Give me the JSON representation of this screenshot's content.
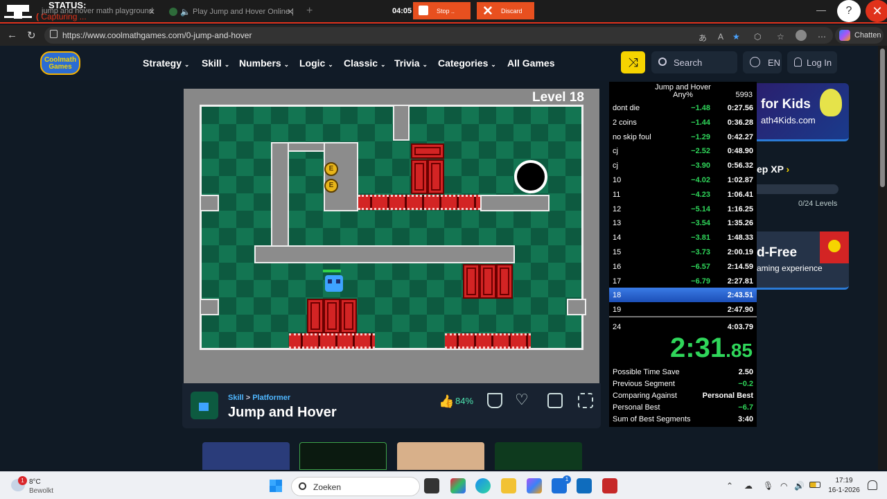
{
  "recorder": {
    "status_label": "STATUS:",
    "capturing_label": "Capturing ...",
    "timer": "04:05",
    "stop_label": "Stop ..",
    "discard_label": "Discard"
  },
  "tabs": [
    {
      "title": "jump and hover math playground"
    },
    {
      "title": "Play Jump and Hover Online |"
    }
  ],
  "browser": {
    "url": "https://www.coolmathgames.com/0-jump-and-hover",
    "chatten_label": "Chatten"
  },
  "site": {
    "logo_text": "Coolmath Games",
    "nav": [
      "Strategy",
      "Skill",
      "Numbers",
      "Logic",
      "Classic",
      "Trivia",
      "Categories",
      "All Games"
    ],
    "search_label": "Search",
    "lang_label": "EN",
    "login_label": "Log In"
  },
  "game": {
    "level_label": "Level 18",
    "category": "Skill",
    "subcategory": "Platformer",
    "title": "Jump and Hover",
    "like_percent": "84%"
  },
  "sidebar": {
    "ad1_title": "for Kids",
    "ad1_sub": "ath4Kids.com",
    "xp_label": "ep XP",
    "levels_label": "0/24 Levels",
    "ad2_title": "d-Free",
    "ad2_sub": "aming experience"
  },
  "splits": {
    "title": "Jump and Hover",
    "category": "Any%",
    "attempts": "5993",
    "rows": [
      {
        "name": "dont die",
        "delta": "−1.48",
        "time": "0:27.56"
      },
      {
        "name": "2 coins",
        "delta": "−1.44",
        "time": "0:36.28"
      },
      {
        "name": "no skip foul",
        "delta": "−1.29",
        "time": "0:42.27"
      },
      {
        "name": "cj",
        "delta": "−2.52",
        "time": "0:48.90"
      },
      {
        "name": "cj",
        "delta": "−3.90",
        "time": "0:56.32"
      },
      {
        "name": "10",
        "delta": "−4.02",
        "time": "1:02.87"
      },
      {
        "name": "11",
        "delta": "−4.23",
        "time": "1:06.41"
      },
      {
        "name": "12",
        "delta": "−5.14",
        "time": "1:16.25"
      },
      {
        "name": "13",
        "delta": "−3.54",
        "time": "1:35.26"
      },
      {
        "name": "14",
        "delta": "−3.81",
        "time": "1:48.33"
      },
      {
        "name": "15",
        "delta": "−3.73",
        "time": "2:00.19"
      },
      {
        "name": "16",
        "delta": "−6.57",
        "time": "2:14.59"
      },
      {
        "name": "17",
        "delta": "−6.79",
        "time": "2:27.81"
      },
      {
        "name": "18",
        "delta": "",
        "time": "2:43.51"
      },
      {
        "name": "19",
        "delta": "",
        "time": "2:47.90"
      },
      {
        "name": "24",
        "delta": "",
        "time": "4:03.79"
      }
    ],
    "current_index": 13,
    "timer_main": "2:31",
    "timer_ms": ".85",
    "info": [
      {
        "label": "Possible Time Save",
        "value": "2.50",
        "value_color": "#ffffff"
      },
      {
        "label": "Previous Segment",
        "value": "−0.2",
        "value_color": "#2fd65a"
      },
      {
        "label": "Comparing Against",
        "value": "Personal Best",
        "value_color": "#ffffff"
      },
      {
        "label": "Personal Best",
        "value": "−6.7",
        "value_color": "#2fd65a"
      },
      {
        "label": "Sum of Best Segments",
        "value": "3:40",
        "value_color": "#ffffff"
      }
    ]
  },
  "taskbar": {
    "temp": "8°C",
    "condition": "Bewolkt",
    "weather_badge": "1",
    "search_label": "Zoeken",
    "app_badge": "1",
    "time": "17:19",
    "date": "16-1-2026"
  }
}
